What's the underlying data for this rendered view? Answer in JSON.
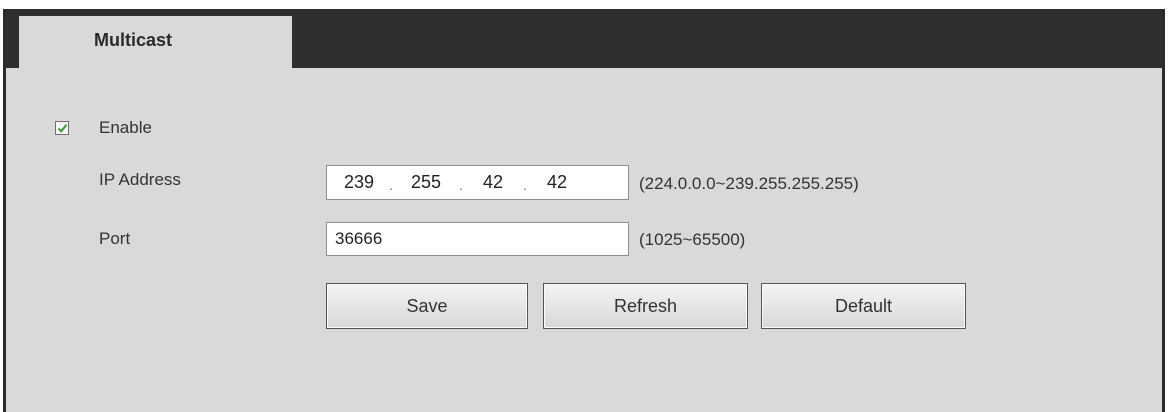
{
  "tab": {
    "label": "Multicast"
  },
  "enable": {
    "label": "Enable",
    "checked": true
  },
  "ip_address": {
    "label": "IP Address",
    "octets": [
      "239",
      "255",
      "42",
      "42"
    ],
    "separator": ".",
    "hint": "(224.0.0.0~239.255.255.255)"
  },
  "port": {
    "label": "Port",
    "value": "36666",
    "hint": "(1025~65500)"
  },
  "buttons": {
    "save": "Save",
    "refresh": "Refresh",
    "default": "Default"
  },
  "colors": {
    "header": "#2e2e2e",
    "panel": "#d9d9d9",
    "check": "#2e9a2e"
  },
  "icons": {
    "checkbox": "checkmark-icon"
  }
}
